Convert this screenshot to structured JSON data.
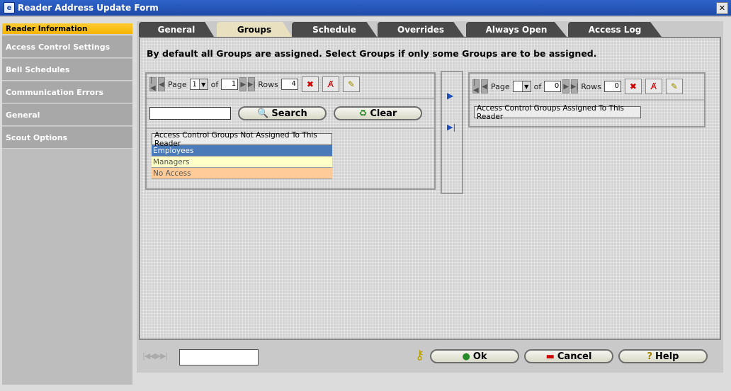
{
  "window": {
    "title": "Reader Address Update Form",
    "close_label": "✕"
  },
  "sidebar": {
    "items": [
      {
        "label": "Reader Information"
      },
      {
        "label": "Access Control Settings"
      },
      {
        "label": "Bell Schedules"
      },
      {
        "label": "Communication Errors"
      },
      {
        "label": "General"
      },
      {
        "label": "Scout Options"
      }
    ]
  },
  "tabs": [
    {
      "label": "General"
    },
    {
      "label": "Groups"
    },
    {
      "label": "Schedule"
    },
    {
      "label": "Overrides"
    },
    {
      "label": "Always Open"
    },
    {
      "label": "Access Log"
    }
  ],
  "instruction": "By default all Groups are assigned. Select Groups if only some Groups are to be assigned.",
  "left_pager": {
    "page_label": "Page",
    "page_value": "1",
    "of_label": "of",
    "total_pages": "1",
    "rows_label": "Rows",
    "rows_value": "4"
  },
  "search": {
    "button_label": "Search",
    "clear_label": "Clear",
    "value": ""
  },
  "unassigned_list": {
    "header": "Access Control Groups Not Assigned To This Reader",
    "rows": [
      {
        "label": "Employees",
        "bg": "#4a7ab8",
        "fg": "#ffffff"
      },
      {
        "label": "Managers",
        "bg": "#ffffc8",
        "fg": "#555555"
      },
      {
        "label": "No Access",
        "bg": "#ffcc99",
        "fg": "#555555"
      }
    ]
  },
  "right_pager": {
    "page_label": "Page",
    "page_value": "",
    "of_label": "of",
    "total_pages": "0",
    "rows_label": "Rows",
    "rows_value": "0"
  },
  "assigned_list": {
    "header": "Access Control Groups Assigned To This Reader"
  },
  "transfer": {
    "move_one_icon": "▶",
    "move_all_icon": "▶|"
  },
  "footer": {
    "nav_icons": "|◀◀▶▶|",
    "input_value": "",
    "ok_label": "Ok",
    "cancel_label": "Cancel",
    "help_label": "Help"
  }
}
